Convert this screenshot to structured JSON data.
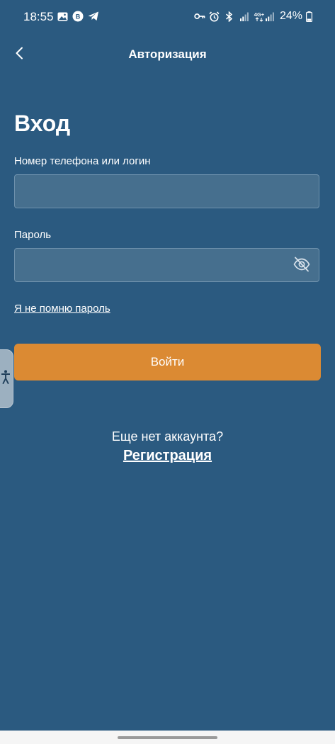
{
  "status_bar": {
    "time": "18:55",
    "left_icons": [
      "gallery-icon",
      "whatsapp-business-icon",
      "telegram-icon"
    ],
    "right_icons": [
      "key-icon",
      "alarm-icon",
      "bluetooth-icon",
      "signal-icon",
      "4g-signal-icon"
    ],
    "network_label": "4G+",
    "battery_percent": "24%"
  },
  "app_bar": {
    "back_icon": "chevron-left-icon",
    "title": "Авторизация"
  },
  "form": {
    "heading": "Вход",
    "login_label": "Номер телефона или логин",
    "login_value": "",
    "password_label": "Пароль",
    "password_value": "",
    "password_toggle_icon": "eye-off-icon",
    "forgot_password": "Я не помню пароль",
    "submit_label": "Войти"
  },
  "footer": {
    "no_account_text": "Еще нет аккаунта?",
    "register_label": "Регистрация"
  },
  "colors": {
    "background": "#2b5a80",
    "input_background": "#466f8e",
    "accent": "#db8a33",
    "text": "#ffffff"
  }
}
